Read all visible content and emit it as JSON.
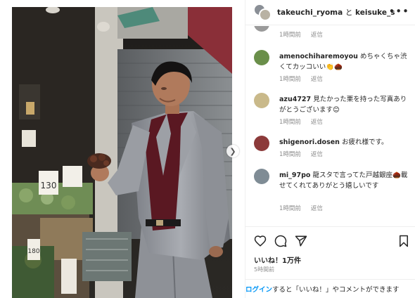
{
  "post": {
    "header": {
      "user1": "takeuchi_ryoma",
      "and": "と",
      "user2": "keisuke_sakai.s",
      "more": "•••"
    },
    "top_meta": {
      "time": "1時間前",
      "reply": "返信"
    },
    "comments": [
      {
        "user": "amenochiharemoyou",
        "text": "めちゃくちゃ渋くてカッコいい👏🌰",
        "time": "1時間前",
        "reply": "返信",
        "avatar_color": "#6a8f4a"
      },
      {
        "user": "azu4727",
        "text": "見たかった栗を持った写真ありがとうございます😊",
        "time": "1時間前",
        "reply": "返信",
        "avatar_color": "#c9b98a"
      },
      {
        "user": "shigenori.dosen",
        "text": "お疲れ様です。",
        "time": "1時間前",
        "reply": "返信",
        "avatar_color": "#8c3a3a"
      },
      {
        "user": "mi_97po",
        "text": "龍スタで言ってた戸越銀座🌰載せてくれてありがとう嬉しいです",
        "time": "1時間前",
        "reply": "返信",
        "avatar_color": "#7f8c95"
      }
    ],
    "icons": {
      "like": "heart-icon",
      "comment": "comment-icon",
      "share": "share-icon",
      "save": "bookmark-icon",
      "next": "chevron-right-icon"
    },
    "likes_label": "いいね！1万件",
    "posted_label": "5時間前",
    "login": {
      "link": "ログイン",
      "rest": "すると「いいね！」やコメントができます"
    },
    "photo_signs": {
      "price1": "130",
      "price2": "180"
    }
  }
}
